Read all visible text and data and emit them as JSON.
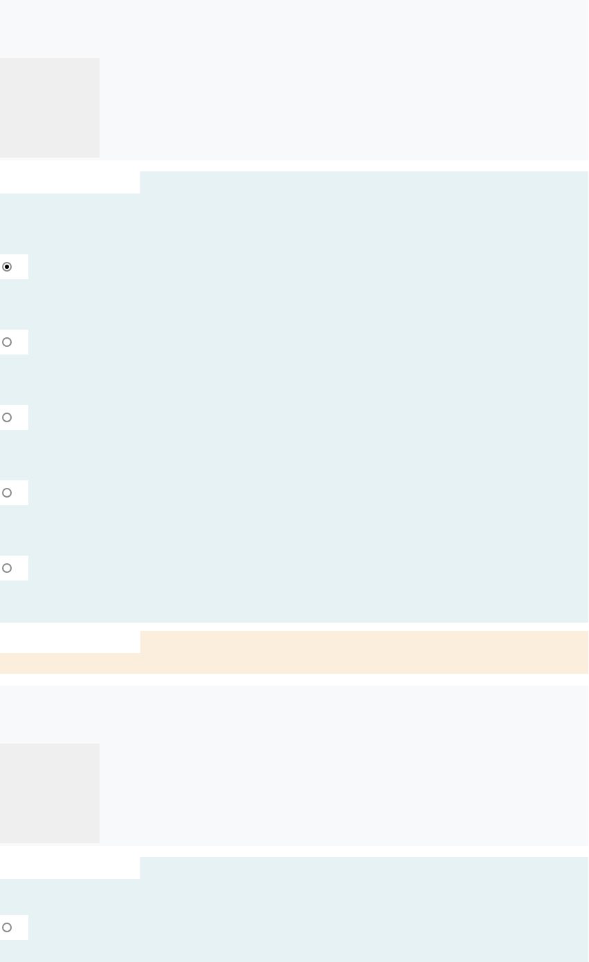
{
  "sections": [
    {
      "kind": "media"
    },
    {
      "kind": "choices",
      "options": [
        {
          "selected": true
        },
        {
          "selected": false
        },
        {
          "selected": false
        },
        {
          "selected": false
        },
        {
          "selected": false
        }
      ]
    },
    {
      "kind": "note"
    },
    {
      "kind": "media"
    },
    {
      "kind": "choices",
      "options": [
        {
          "selected": false
        }
      ]
    }
  ]
}
